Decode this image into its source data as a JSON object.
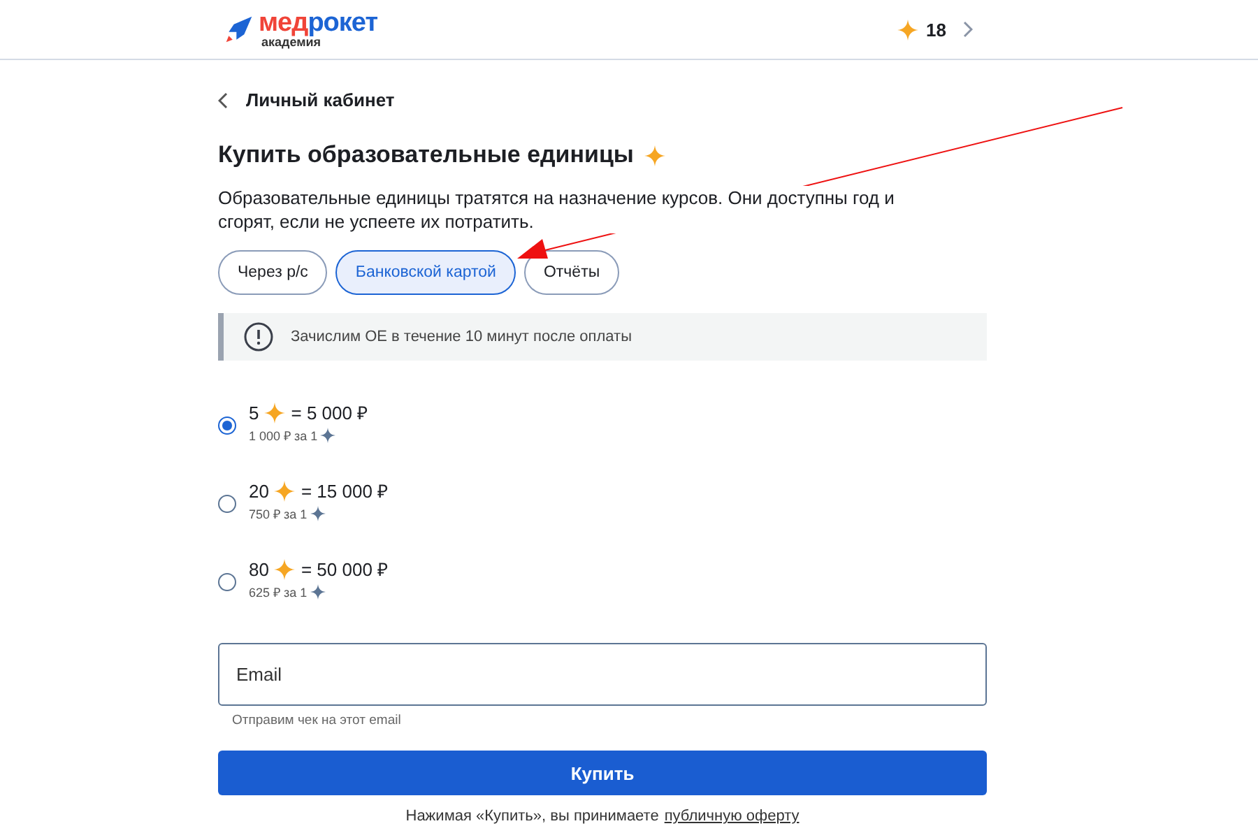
{
  "header": {
    "logo": {
      "part_1": "мед",
      "part_2": "рокет",
      "subtitle": "академия"
    },
    "balance": "18"
  },
  "back_link": "Личный кабинет",
  "title": "Купить образовательные единицы",
  "description": "Образовательные единицы тратятся на назначение курсов. Они доступны год и сгорят, если не успеете их потратить.",
  "tabs": [
    {
      "label": "Через р/с",
      "selected": false
    },
    {
      "label": "Банковской картой",
      "selected": true
    },
    {
      "label": "Отчёты",
      "selected": false
    }
  ],
  "notice": "Зачислим ОЕ в течение 10 минут после оплаты",
  "options": [
    {
      "amount": "5",
      "price": "= 5 000 ₽",
      "rate": "1 000 ₽ за 1",
      "selected": true
    },
    {
      "amount": "20",
      "price": "= 15 000 ₽",
      "rate": "750 ₽ за 1",
      "selected": false
    },
    {
      "amount": "80",
      "price": "= 50 000 ₽",
      "rate": "625 ₽ за 1",
      "selected": false
    }
  ],
  "email": {
    "placeholder": "Email",
    "hint": "Отправим чек на этот email"
  },
  "buy_button": "Купить",
  "agreement": {
    "text": "Нажимая «Купить», вы принимаете",
    "link": "публичную оферту"
  }
}
